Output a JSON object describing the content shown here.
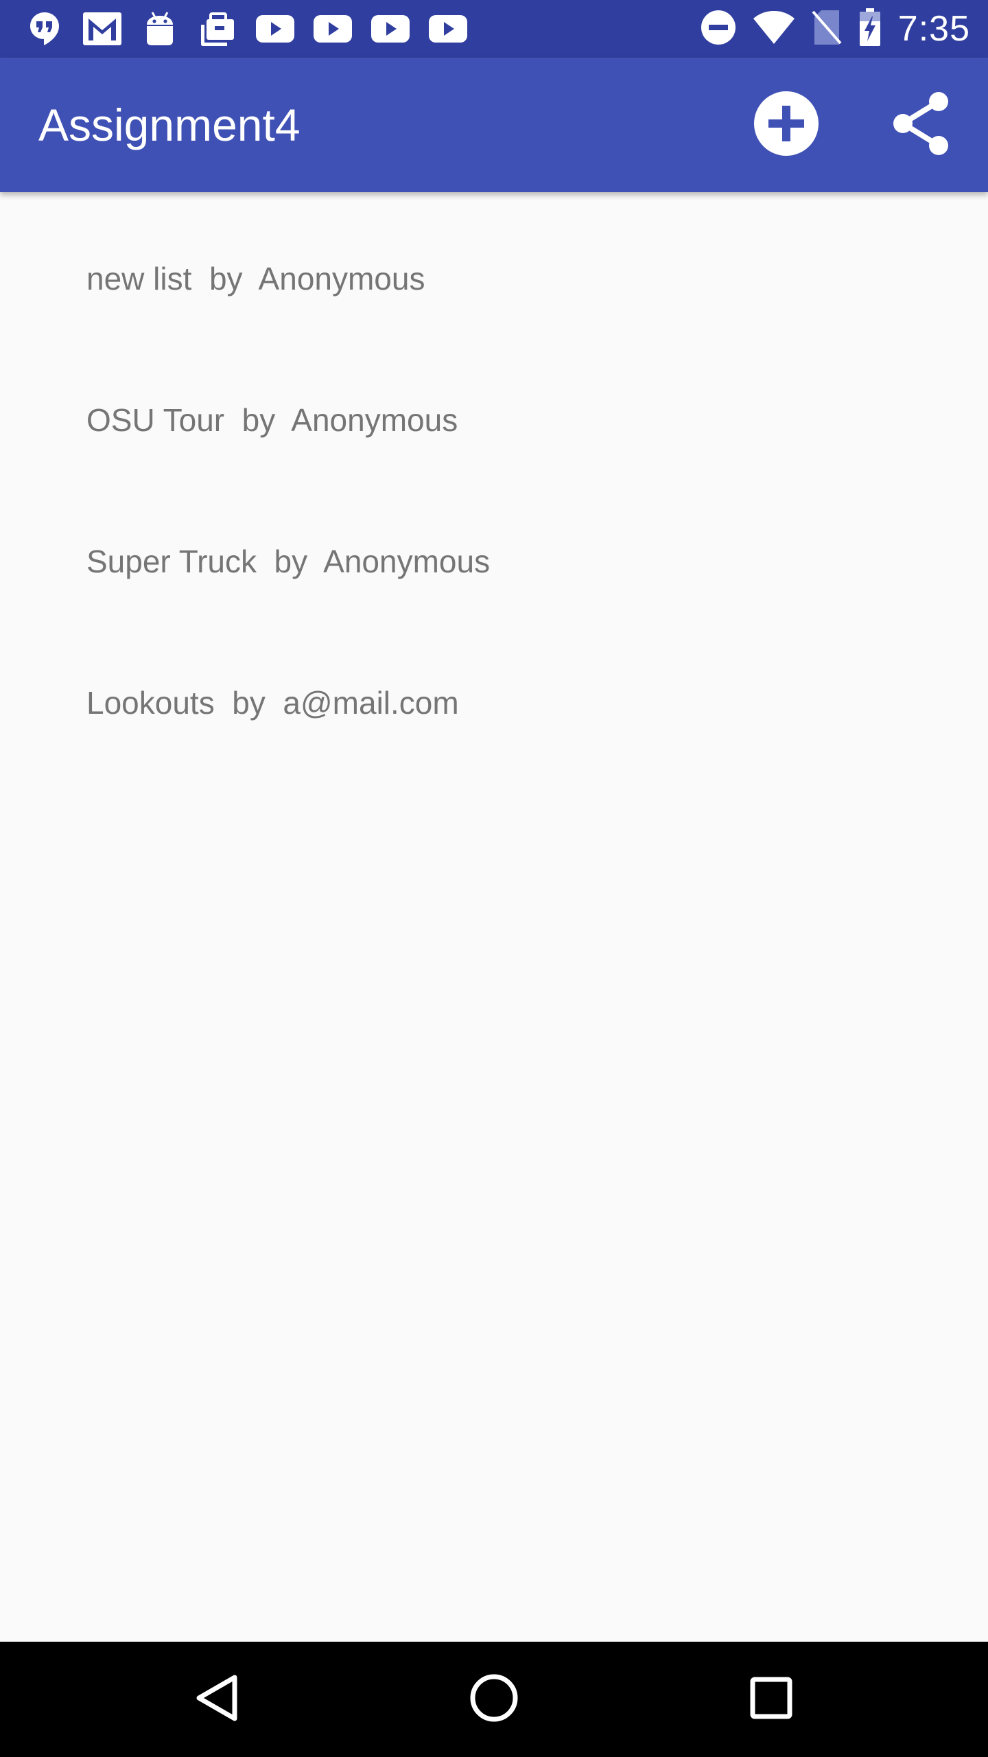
{
  "status_bar": {
    "time": "7:35",
    "left_icons": [
      "hangouts-icon",
      "gmail-icon",
      "android-icon",
      "briefcase-icon",
      "youtube-icon",
      "youtube-icon",
      "youtube-icon",
      "youtube-icon"
    ],
    "right_icons": [
      "do-not-disturb-icon",
      "wifi-icon",
      "no-sim-icon",
      "battery-charging-icon"
    ],
    "color": "#303F9F"
  },
  "app_bar": {
    "title": "Assignment4",
    "color": "#3F51B5",
    "actions": [
      "add-circle-icon",
      "share-icon"
    ]
  },
  "list": {
    "items": [
      {
        "label": "new list  by  Anonymous"
      },
      {
        "label": "OSU Tour  by  Anonymous"
      },
      {
        "label": "Super Truck  by  Anonymous"
      },
      {
        "label": "Lookouts  by  a@mail.com"
      }
    ],
    "text_color": "#757575"
  },
  "nav_bar": {
    "buttons": [
      "back-icon",
      "home-icon",
      "recents-icon"
    ],
    "color": "#000000"
  }
}
